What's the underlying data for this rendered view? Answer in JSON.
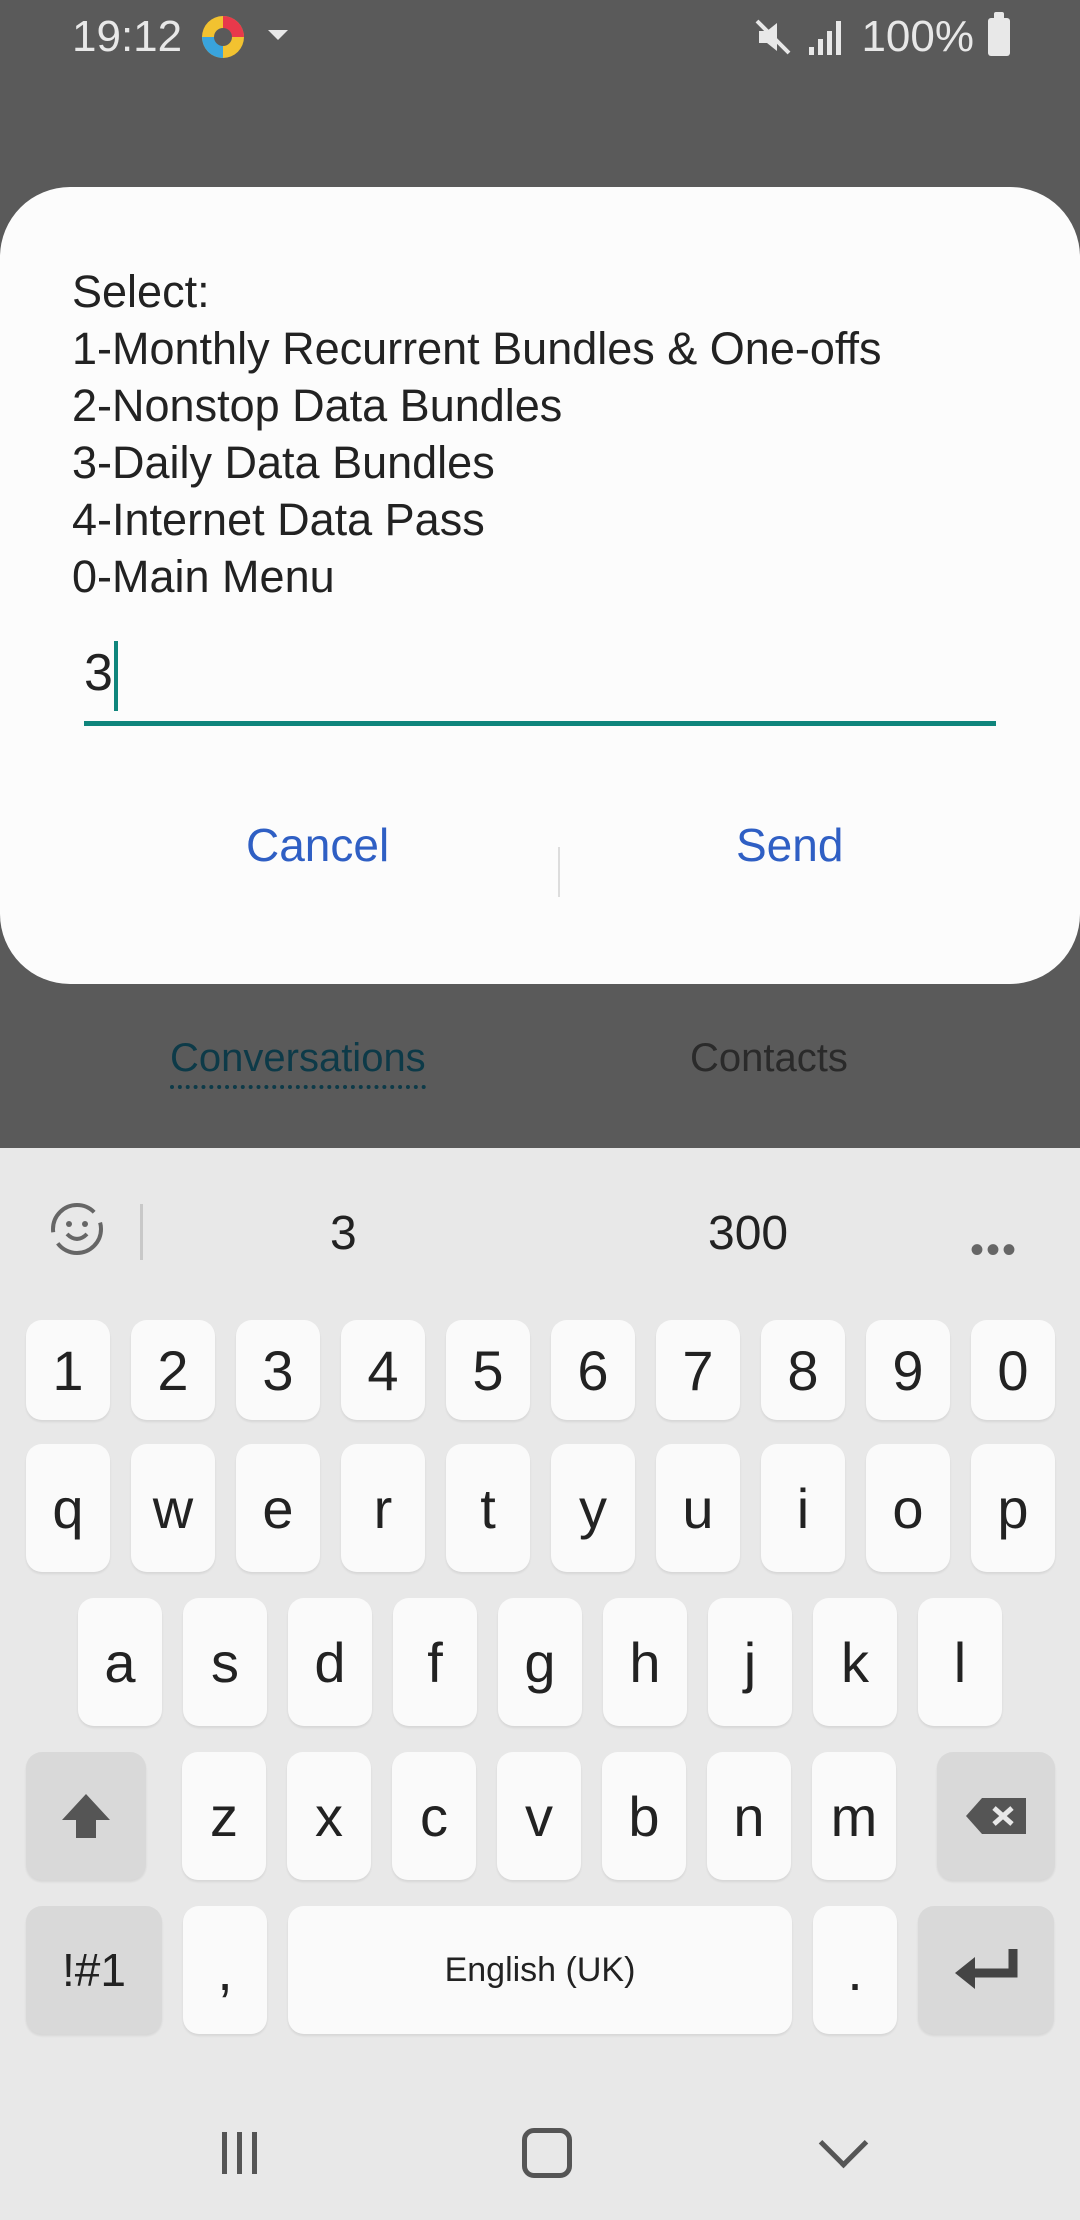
{
  "status_bar": {
    "time": "19:12",
    "battery": "100%",
    "icons": [
      "app-notification-icon",
      "mute-icon",
      "signal-icon",
      "battery-icon"
    ]
  },
  "tabs": {
    "conversations": "Conversations",
    "contacts": "Contacts"
  },
  "dialog": {
    "lines": [
      "Select:",
      "1-Monthly Recurrent Bundles & One-offs",
      "2-Nonstop Data Bundles",
      "3-Daily Data Bundles",
      "4-Internet Data Pass",
      "0-Main Menu"
    ],
    "input_value": "3",
    "cancel_label": "Cancel",
    "send_label": "Send",
    "accent_color": "#0f857c",
    "button_color": "#2f5fc4"
  },
  "keyboard": {
    "suggestions": [
      "3",
      "300"
    ],
    "more": "•••",
    "rows": [
      [
        "1",
        "2",
        "3",
        "4",
        "5",
        "6",
        "7",
        "8",
        "9",
        "0"
      ],
      [
        "q",
        "w",
        "e",
        "r",
        "t",
        "y",
        "u",
        "i",
        "o",
        "p"
      ],
      [
        "a",
        "s",
        "d",
        "f",
        "g",
        "h",
        "j",
        "k",
        "l"
      ],
      [
        "z",
        "x",
        "c",
        "v",
        "b",
        "n",
        "m"
      ]
    ],
    "symbols_label": "!#1",
    "comma": ",",
    "space_label": "English (UK)",
    "period": "."
  }
}
